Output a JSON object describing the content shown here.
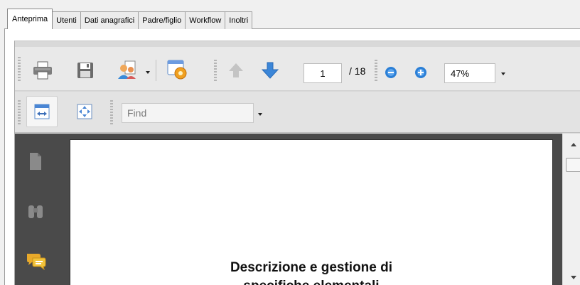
{
  "tabs": [
    {
      "label": "Anteprima",
      "active": true
    },
    {
      "label": "Utenti",
      "active": false
    },
    {
      "label": "Dati anagrafici",
      "active": false
    },
    {
      "label": "Padre/figlio",
      "active": false
    },
    {
      "label": "Workflow",
      "active": false
    },
    {
      "label": "Inoltri",
      "active": false
    }
  ],
  "toolbar": {
    "icons": [
      "print-icon",
      "save-icon",
      "users-icon",
      "settings-icon",
      "arrow-up-icon",
      "arrow-down-icon",
      "zoom-out-icon",
      "zoom-in-icon"
    ],
    "current_page": "1",
    "total_pages": "/ 18",
    "zoom": "47%"
  },
  "toolbar2": {
    "find_placeholder": "Find"
  },
  "document": {
    "line1": "Descrizione e gestione di",
    "line2": "specifiche elementali"
  },
  "colors": {
    "panel_dark": "#4a4a4a",
    "arrow_blue": "#3b86d8",
    "zoom_blue": "#2b7fd6"
  }
}
